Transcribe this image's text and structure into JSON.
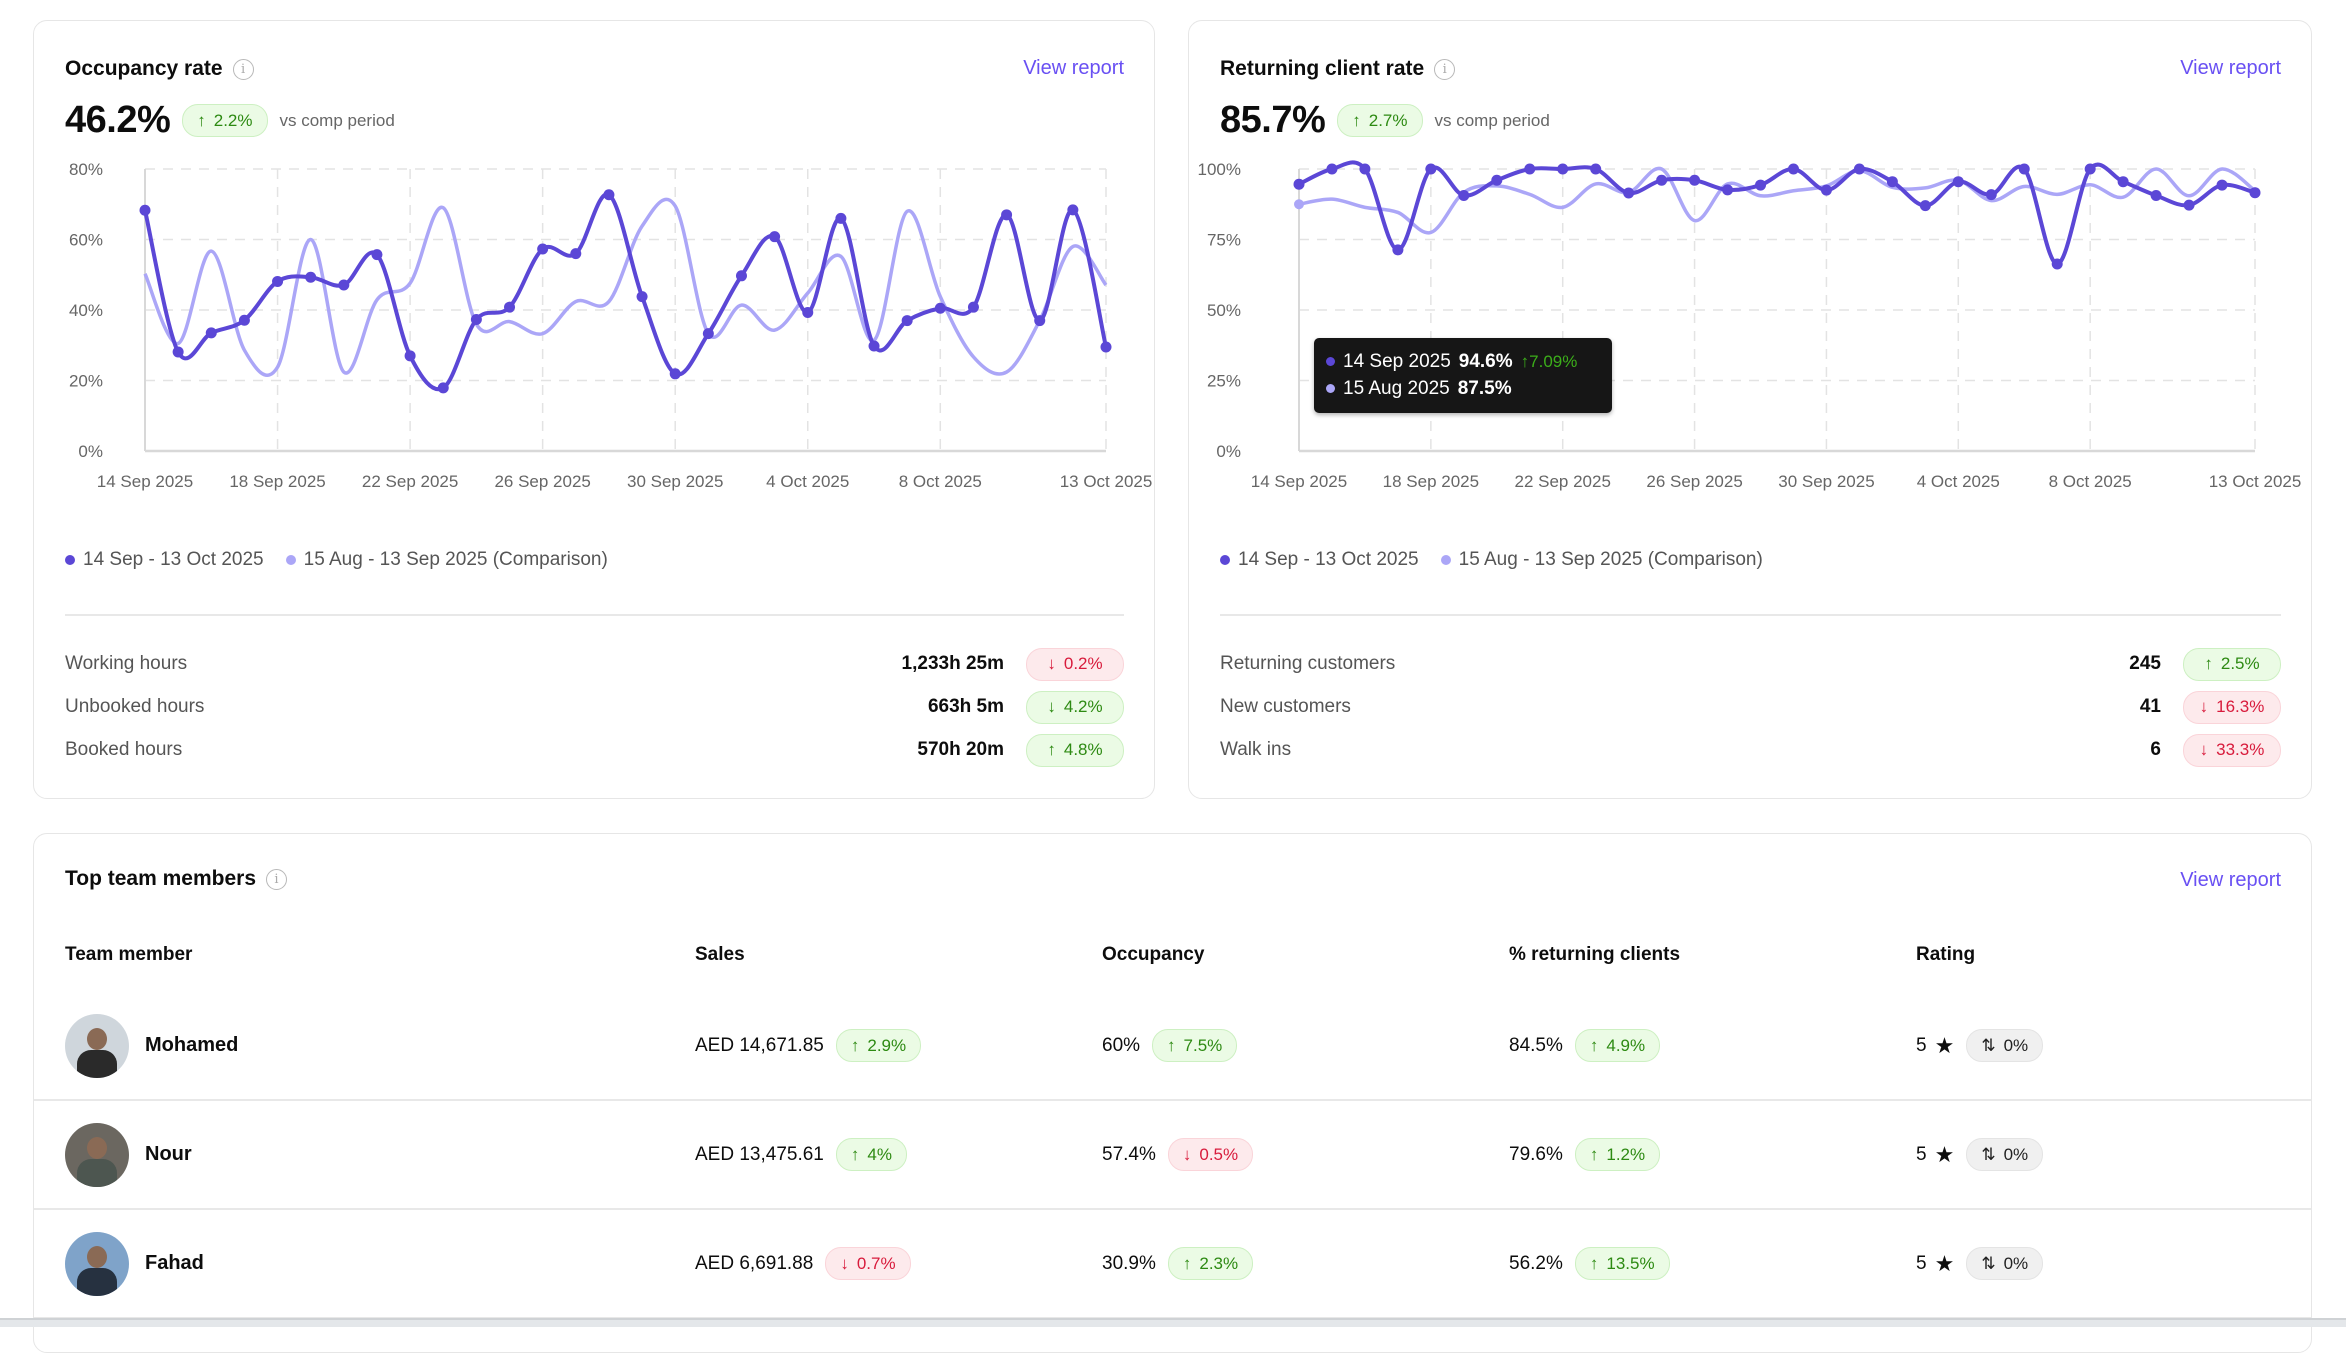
{
  "colors": {
    "primary": "#5b47d6",
    "comparison": "#aba6f7",
    "link": "#6950f3",
    "green": "#2d8a12",
    "red": "#d81b3c"
  },
  "occupancy": {
    "title": "Occupancy rate",
    "info_icon": "info-icon",
    "view_report": "View report",
    "value": "46.2%",
    "change": "2.2%",
    "change_dir": "up",
    "vs": "vs comp period",
    "legend": [
      "14 Sep - 13 Oct 2025",
      "15 Aug - 13 Sep 2025 (Comparison)"
    ],
    "stats": [
      {
        "label": "Working hours",
        "value": "1,233h 25m",
        "change": "0.2%",
        "arrow": "↓",
        "tone": "down"
      },
      {
        "label": "Unbooked hours",
        "value": "663h 5m",
        "change": "4.2%",
        "arrow": "↓",
        "tone": "up"
      },
      {
        "label": "Booked hours",
        "value": "570h 20m",
        "change": "4.8%",
        "arrow": "↑",
        "tone": "up"
      }
    ]
  },
  "returning": {
    "title": "Returning client rate",
    "info_icon": "info-icon",
    "view_report": "View report",
    "value": "85.7%",
    "change": "2.7%",
    "change_dir": "up",
    "vs": "vs comp period",
    "legend": [
      "14 Sep - 13 Oct 2025",
      "15 Aug - 13 Sep 2025 (Comparison)"
    ],
    "tooltip": {
      "date1": "14 Sep 2025",
      "val1": "94.6%",
      "chg1": "↑7.09%",
      "date2": "15 Aug 2025",
      "val2": "87.5%"
    },
    "stats": [
      {
        "label": "Returning customers",
        "value": "245",
        "change": "2.5%",
        "arrow": "↑",
        "tone": "up"
      },
      {
        "label": "New customers",
        "value": "41",
        "change": "16.3%",
        "arrow": "↓",
        "tone": "down"
      },
      {
        "label": "Walk ins",
        "value": "6",
        "change": "33.3%",
        "arrow": "↓",
        "tone": "down"
      }
    ]
  },
  "chart_data": [
    {
      "type": "line",
      "title": "Occupancy rate",
      "ylim": [
        0,
        80
      ],
      "yticks": [
        "0%",
        "20%",
        "40%",
        "60%",
        "80%"
      ],
      "ytick_values": [
        0,
        20,
        40,
        60,
        80
      ],
      "xticks": [
        "14 Sep 2025",
        "18 Sep 2025",
        "22 Sep 2025",
        "26 Sep 2025",
        "30 Sep 2025",
        "4 Oct 2025",
        "8 Oct 2025",
        "13 Oct 2025"
      ],
      "xtick_index": [
        0,
        4,
        8,
        12,
        16,
        20,
        24,
        29
      ],
      "series": [
        {
          "name": "14 Sep - 13 Oct 2025",
          "values": [
            68.3,
            28.1,
            33.5,
            37.1,
            48.1,
            49.3,
            47.1,
            55.7,
            27,
            17.9,
            37.3,
            40.8,
            57.3,
            56,
            72.7,
            43.8,
            21.9,
            33.3,
            49.7,
            60.8,
            39.3,
            66,
            29.8,
            37,
            40.5,
            40.8,
            67,
            37,
            68.4,
            29.5
          ]
        },
        {
          "name": "15 Aug - 13 Sep 2025 (Comparison)",
          "values": [
            50.3,
            30.5,
            56.7,
            28.6,
            23.8,
            60,
            22.4,
            42.9,
            47.6,
            69,
            36,
            36.7,
            33.3,
            42.4,
            42.4,
            63.8,
            69.5,
            33.3,
            41.4,
            34.3,
            44.8,
            55.2,
            31.4,
            68,
            43.8,
            26.7,
            22.4,
            37,
            58,
            47.1
          ]
        }
      ]
    },
    {
      "type": "line",
      "title": "Returning client rate",
      "ylim": [
        0,
        100
      ],
      "yticks": [
        "0%",
        "25%",
        "50%",
        "75%",
        "100%"
      ],
      "ytick_values": [
        0,
        25,
        50,
        75,
        100
      ],
      "xticks": [
        "14 Sep 2025",
        "18 Sep 2025",
        "22 Sep 2025",
        "26 Sep 2025",
        "30 Sep 2025",
        "4 Oct 2025",
        "8 Oct 2025",
        "13 Oct 2025"
      ],
      "xtick_index": [
        0,
        4,
        8,
        12,
        16,
        20,
        24,
        29
      ],
      "series": [
        {
          "name": "14 Sep - 13 Oct 2025",
          "values": [
            94.6,
            100,
            100,
            71.3,
            100,
            90.6,
            96,
            100,
            100,
            100,
            91.5,
            96,
            96,
            92.6,
            94.3,
            100,
            92.5,
            100,
            95.5,
            87,
            95.5,
            90.9,
            100,
            66.3,
            100,
            95.5,
            90.6,
            87.2,
            94.3,
            91.6
          ]
        },
        {
          "name": "15 Aug - 13 Sep 2025 (Comparison)",
          "values": [
            87.5,
            89.3,
            86.4,
            84.6,
            77.5,
            91.7,
            94,
            91,
            86.4,
            94.7,
            91.7,
            100,
            81.7,
            94.7,
            90.5,
            92.3,
            94,
            99.4,
            93.5,
            93.3,
            96,
            88.8,
            93.8,
            91,
            94.4,
            90,
            100,
            90.5,
            100,
            92.3
          ]
        }
      ]
    }
  ],
  "team": {
    "title": "Top team members",
    "view_report": "View report",
    "columns": [
      "Team member",
      "Sales",
      "Occupancy",
      "% returning clients",
      "Rating"
    ],
    "rows": [
      {
        "name": "Mohamed",
        "sales": "AED 14,671.85",
        "sales_chg": "2.9%",
        "sales_arrow": "↑",
        "sales_tone": "up",
        "occ": "60%",
        "occ_chg": "7.5%",
        "occ_arrow": "↑",
        "occ_tone": "up",
        "ret": "84.5%",
        "ret_chg": "4.9%",
        "ret_arrow": "↑",
        "ret_tone": "up",
        "rating": "5",
        "rating_chg": "0%"
      },
      {
        "name": "Nour",
        "sales": "AED 13,475.61",
        "sales_chg": "4%",
        "sales_arrow": "↑",
        "sales_tone": "up",
        "occ": "57.4%",
        "occ_chg": "0.5%",
        "occ_arrow": "↓",
        "occ_tone": "down",
        "ret": "79.6%",
        "ret_chg": "1.2%",
        "ret_arrow": "↑",
        "ret_tone": "up",
        "rating": "5",
        "rating_chg": "0%"
      },
      {
        "name": "Fahad",
        "sales": "AED 6,691.88",
        "sales_chg": "0.7%",
        "sales_arrow": "↓",
        "sales_tone": "down",
        "occ": "30.9%",
        "occ_chg": "2.3%",
        "occ_arrow": "↑",
        "occ_tone": "up",
        "ret": "56.2%",
        "ret_chg": "13.5%",
        "ret_arrow": "↑",
        "ret_tone": "up",
        "rating": "5",
        "rating_chg": "0%"
      }
    ]
  }
}
